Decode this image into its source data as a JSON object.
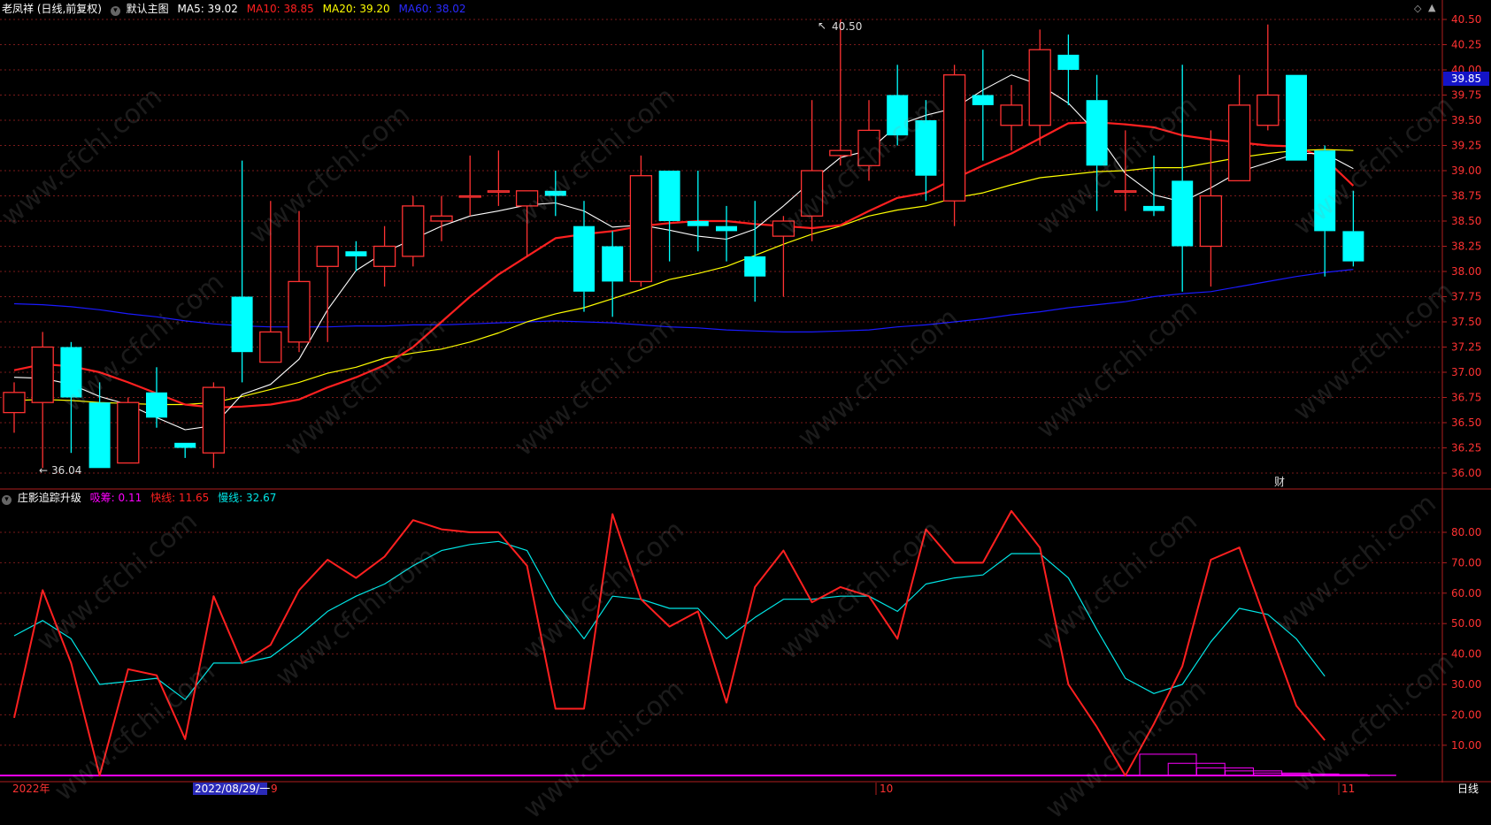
{
  "header": {
    "stock": "老凤祥 (日线,前复权)",
    "main_menu": "默认主图",
    "ma5": "MA5: 39.02",
    "ma10": "MA10: 38.85",
    "ma20": "MA20: 39.20",
    "ma60": "MA60: 38.02"
  },
  "sub_header": {
    "indicator": "庄影追踪升级",
    "xichou": "吸筹: 0.11",
    "kuai": "快线: 11.65",
    "man": "慢线: 32.67"
  },
  "annotations": {
    "high": "40.50",
    "low": "36.04",
    "cai": "财",
    "current_price": "39.85"
  },
  "x_axis": {
    "year": "2022年",
    "cursor_date": "2022/08/29/一",
    "m9": "9",
    "m10": "10",
    "m11": "11"
  },
  "period_tab": "日线",
  "watermark": "www.cfchi.com",
  "colors": {
    "up": "#ff3232",
    "down": "#00ffff",
    "ma5": "#ffffff",
    "ma10": "#ff2020",
    "ma20": "#ffff00",
    "ma60": "#1a1aff",
    "kuai": "#ff2020",
    "man": "#00e6e6",
    "xichou": "#ff00ff",
    "grid": "#7a1a1a"
  },
  "chart_data": [
    {
      "type": "candlestick",
      "title": "老凤祥 (日线,前复权)",
      "y_ticks": [
        "40.50",
        "40.25",
        "40.00",
        "39.75",
        "39.50",
        "39.25",
        "39.00",
        "38.75",
        "38.50",
        "38.25",
        "38.00",
        "37.75",
        "37.50",
        "37.25",
        "37.00",
        "36.75",
        "36.50",
        "36.25",
        "36.00"
      ],
      "ylim": [
        35.95,
        40.55
      ],
      "candles": [
        {
          "o": 36.6,
          "h": 36.9,
          "l": 36.4,
          "c": 36.8
        },
        {
          "o": 36.7,
          "h": 37.4,
          "l": 36.05,
          "c": 37.25
        },
        {
          "o": 37.25,
          "h": 37.3,
          "l": 36.2,
          "c": 36.75
        },
        {
          "o": 36.7,
          "h": 36.9,
          "l": 36.05,
          "c": 36.05
        },
        {
          "o": 36.1,
          "h": 36.75,
          "l": 36.1,
          "c": 36.7
        },
        {
          "o": 36.8,
          "h": 37.05,
          "l": 36.45,
          "c": 36.55
        },
        {
          "o": 36.3,
          "h": 36.3,
          "l": 36.15,
          "c": 36.25
        },
        {
          "o": 36.2,
          "h": 36.9,
          "l": 36.05,
          "c": 36.85
        },
        {
          "o": 37.75,
          "h": 39.1,
          "l": 36.9,
          "c": 37.2
        },
        {
          "o": 37.1,
          "h": 38.7,
          "l": 37.1,
          "c": 37.4
        },
        {
          "o": 37.3,
          "h": 38.6,
          "l": 37.2,
          "c": 37.9
        },
        {
          "o": 38.05,
          "h": 38.25,
          "l": 37.3,
          "c": 38.25
        },
        {
          "o": 38.2,
          "h": 38.3,
          "l": 38.0,
          "c": 38.15
        },
        {
          "o": 38.05,
          "h": 38.45,
          "l": 37.85,
          "c": 38.25
        },
        {
          "o": 38.15,
          "h": 38.75,
          "l": 38.05,
          "c": 38.65
        },
        {
          "o": 38.5,
          "h": 38.75,
          "l": 38.3,
          "c": 38.55
        },
        {
          "o": 38.75,
          "h": 39.15,
          "l": 38.55,
          "c": 38.75
        },
        {
          "o": 38.8,
          "h": 39.2,
          "l": 38.65,
          "c": 38.8
        },
        {
          "o": 38.65,
          "h": 38.8,
          "l": 38.15,
          "c": 38.8
        },
        {
          "o": 38.8,
          "h": 39.0,
          "l": 38.55,
          "c": 38.75
        },
        {
          "o": 38.45,
          "h": 38.7,
          "l": 37.6,
          "c": 37.8
        },
        {
          "o": 38.25,
          "h": 38.4,
          "l": 37.55,
          "c": 37.9
        },
        {
          "o": 37.9,
          "h": 39.15,
          "l": 37.85,
          "c": 38.95
        },
        {
          "o": 39.0,
          "h": 39.0,
          "l": 38.1,
          "c": 38.5
        },
        {
          "o": 38.5,
          "h": 39.0,
          "l": 38.2,
          "c": 38.45
        },
        {
          "o": 38.45,
          "h": 38.65,
          "l": 38.1,
          "c": 38.4
        },
        {
          "o": 38.15,
          "h": 38.7,
          "l": 37.7,
          "c": 37.95
        },
        {
          "o": 38.35,
          "h": 38.55,
          "l": 37.75,
          "c": 38.5
        },
        {
          "o": 38.55,
          "h": 39.7,
          "l": 38.3,
          "c": 39.0
        },
        {
          "o": 39.15,
          "h": 40.5,
          "l": 39.05,
          "c": 39.2
        },
        {
          "o": 39.05,
          "h": 39.7,
          "l": 38.9,
          "c": 39.4
        },
        {
          "o": 39.75,
          "h": 40.05,
          "l": 39.25,
          "c": 39.35
        },
        {
          "o": 39.5,
          "h": 39.7,
          "l": 38.7,
          "c": 38.95
        },
        {
          "o": 38.7,
          "h": 40.05,
          "l": 38.45,
          "c": 39.95
        },
        {
          "o": 39.75,
          "h": 40.2,
          "l": 39.1,
          "c": 39.65
        },
        {
          "o": 39.45,
          "h": 39.85,
          "l": 39.2,
          "c": 39.65
        },
        {
          "o": 39.45,
          "h": 40.4,
          "l": 39.25,
          "c": 40.2
        },
        {
          "o": 40.15,
          "h": 40.35,
          "l": 39.65,
          "c": 40.0
        },
        {
          "o": 39.7,
          "h": 39.95,
          "l": 38.6,
          "c": 39.05
        },
        {
          "o": 38.8,
          "h": 39.4,
          "l": 38.6,
          "c": 38.8
        },
        {
          "o": 38.65,
          "h": 39.15,
          "l": 38.55,
          "c": 38.6
        },
        {
          "o": 38.9,
          "h": 40.05,
          "l": 37.8,
          "c": 38.25
        },
        {
          "o": 38.25,
          "h": 39.4,
          "l": 37.85,
          "c": 38.75
        },
        {
          "o": 38.9,
          "h": 39.95,
          "l": 38.9,
          "c": 39.65
        },
        {
          "o": 39.45,
          "h": 40.45,
          "l": 39.4,
          "c": 39.75
        },
        {
          "o": 39.95,
          "h": 39.95,
          "l": 39.1,
          "c": 39.1
        },
        {
          "o": 39.2,
          "h": 39.25,
          "l": 37.95,
          "c": 38.4
        },
        {
          "o": 38.4,
          "h": 38.8,
          "l": 38.05,
          "c": 38.1
        }
      ],
      "ma5": [
        36.95,
        36.94,
        36.88,
        36.76,
        36.68,
        36.55,
        36.43,
        36.47,
        36.78,
        36.88,
        37.13,
        37.62,
        38.01,
        38.19,
        38.32,
        38.45,
        38.55,
        38.6,
        38.66,
        38.68,
        38.6,
        38.44,
        38.46,
        38.41,
        38.35,
        38.32,
        38.42,
        38.65,
        38.9,
        39.13,
        39.2,
        39.45,
        39.55,
        39.62,
        39.8,
        39.95,
        39.85,
        39.67,
        39.37,
        38.97,
        38.76,
        38.69,
        38.83,
        38.99,
        39.08,
        39.17,
        39.17,
        39.02
      ],
      "ma10": [
        37.02,
        37.08,
        37.06,
        37.0,
        36.9,
        36.79,
        36.68,
        36.65,
        36.66,
        36.68,
        36.73,
        36.85,
        36.95,
        37.07,
        37.25,
        37.5,
        37.75,
        37.97,
        38.15,
        38.33,
        38.37,
        38.4,
        38.45,
        38.48,
        38.5,
        38.5,
        38.47,
        38.45,
        38.43,
        38.46,
        38.6,
        38.73,
        38.78,
        38.92,
        39.05,
        39.17,
        39.32,
        39.47,
        39.48,
        39.46,
        39.43,
        39.35,
        39.31,
        39.28,
        39.25,
        39.24,
        39.12,
        38.85
      ],
      "ma20": [
        36.72,
        36.73,
        36.72,
        36.7,
        36.69,
        36.68,
        36.68,
        36.7,
        36.76,
        36.83,
        36.9,
        36.99,
        37.05,
        37.14,
        37.19,
        37.23,
        37.3,
        37.39,
        37.5,
        37.58,
        37.64,
        37.73,
        37.82,
        37.92,
        37.98,
        38.05,
        38.16,
        38.27,
        38.37,
        38.45,
        38.55,
        38.61,
        38.65,
        38.73,
        38.78,
        38.86,
        38.93,
        38.96,
        38.99,
        39.0,
        39.03,
        39.03,
        39.08,
        39.13,
        39.17,
        39.2,
        39.21,
        39.2
      ],
      "ma60": [
        37.68,
        37.67,
        37.65,
        37.62,
        37.58,
        37.55,
        37.51,
        37.48,
        37.46,
        37.45,
        37.45,
        37.45,
        37.46,
        37.46,
        37.47,
        37.47,
        37.48,
        37.49,
        37.5,
        37.51,
        37.5,
        37.49,
        37.47,
        37.45,
        37.44,
        37.42,
        37.41,
        37.4,
        37.4,
        37.41,
        37.42,
        37.45,
        37.47,
        37.5,
        37.53,
        37.57,
        37.6,
        37.64,
        37.67,
        37.7,
        37.75,
        37.78,
        37.8,
        37.85,
        37.9,
        37.95,
        37.99,
        38.02
      ]
    },
    {
      "type": "line",
      "title": "庄影追踪升级",
      "y_ticks": [
        "80.00",
        "70.00",
        "60.00",
        "50.00",
        "40.00",
        "30.00",
        "20.00",
        "10.00"
      ],
      "ylim": [
        -1,
        91
      ],
      "series": [
        {
          "name": "快线",
          "values": [
            19,
            61,
            37,
            0,
            35,
            33,
            12,
            59,
            37,
            43,
            61,
            71,
            65,
            72,
            84,
            81,
            80,
            80,
            69,
            22,
            22,
            86,
            58,
            49,
            54,
            24,
            62,
            74,
            57,
            62,
            59,
            45,
            81,
            70,
            70,
            87,
            75,
            30,
            16,
            0,
            17,
            36,
            71,
            75,
            49,
            23,
            11.65
          ]
        },
        {
          "name": "慢线",
          "values": [
            46,
            51,
            45,
            30,
            31,
            32,
            25,
            37,
            37,
            39,
            46,
            54,
            59,
            63,
            69,
            74,
            76,
            77,
            74,
            57,
            45,
            59,
            58,
            55,
            55,
            45,
            52,
            58,
            58,
            59,
            59,
            54,
            63,
            65,
            66,
            73,
            73,
            65,
            48,
            32,
            27,
            30,
            44,
            55,
            53,
            45,
            32.67
          ]
        },
        {
          "name": "吸筹",
          "values": [
            0,
            0,
            0,
            0,
            0,
            0,
            0,
            0,
            0,
            0,
            0,
            0,
            0,
            0,
            0,
            0,
            0,
            0,
            0,
            0,
            0,
            0,
            0,
            0,
            0,
            0,
            0,
            0,
            0,
            0,
            0,
            0,
            0,
            0,
            0,
            0,
            0,
            0,
            0,
            7,
            4,
            2.5,
            1.5,
            0.8,
            0.5,
            0.3,
            0.11
          ]
        }
      ]
    }
  ]
}
